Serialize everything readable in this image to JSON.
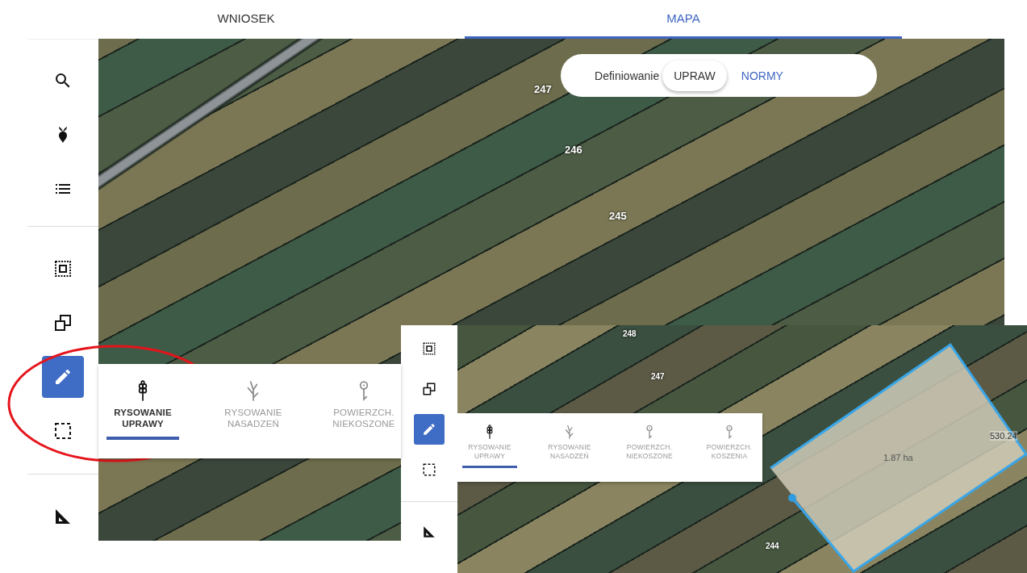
{
  "tabs": [
    {
      "label": "WNIOSEK",
      "selected": false
    },
    {
      "label": "MAPA",
      "selected": true
    }
  ],
  "sidebar": {
    "groups": [
      [
        {
          "kind": "search",
          "selected": false
        },
        {
          "kind": "crop",
          "selected": false
        },
        {
          "kind": "list",
          "selected": false
        }
      ],
      [
        {
          "kind": "select",
          "selected": false
        },
        {
          "kind": "copy",
          "selected": false
        },
        {
          "kind": "draw",
          "selected": true
        },
        {
          "kind": "rectangle",
          "selected": false
        }
      ],
      [
        {
          "kind": "measure",
          "selected": false
        }
      ]
    ]
  },
  "mode_switch": {
    "label": "Definiowanie",
    "options": [
      {
        "label": "UPRAW",
        "selected": true
      },
      {
        "label": "NORMY",
        "selected": false
      }
    ]
  },
  "map": {
    "parcel_labels": [
      "247",
      "246",
      "245"
    ]
  },
  "draw_menu": {
    "items": [
      {
        "kind": "crop",
        "label": "RYSOWANIE UPRAWY",
        "selected": true
      },
      {
        "kind": "sapling",
        "label": "RYSOWANIE NASADZEŃ",
        "selected": false
      },
      {
        "kind": "pin",
        "label": "POWIERZCH. NIEKOSZONE",
        "selected": false
      }
    ]
  },
  "inset": {
    "sidebar": {
      "groups": [
        [
          {
            "kind": "select",
            "selected": false
          },
          {
            "kind": "copy",
            "selected": false
          },
          {
            "kind": "draw",
            "selected": true
          },
          {
            "kind": "rectangle",
            "selected": false
          }
        ],
        [
          {
            "kind": "measure",
            "selected": false
          }
        ]
      ]
    },
    "map": {
      "parcel_labels": [
        "248",
        "247",
        "244"
      ],
      "area": "1.87 ha",
      "edge_length": "530.24"
    },
    "draw_menu": {
      "items": [
        {
          "kind": "crop",
          "label": "RYSOWANIE UPRAWY",
          "selected": true
        },
        {
          "kind": "sapling",
          "label": "RYSOWANIE NASADZEŃ",
          "selected": false
        },
        {
          "kind": "pin",
          "label": "POWIERZCH. NIEKOSZONE",
          "selected": false
        },
        {
          "kind": "pin",
          "label": "POWIERZCH. KOSZENIA",
          "selected": false
        }
      ]
    }
  }
}
